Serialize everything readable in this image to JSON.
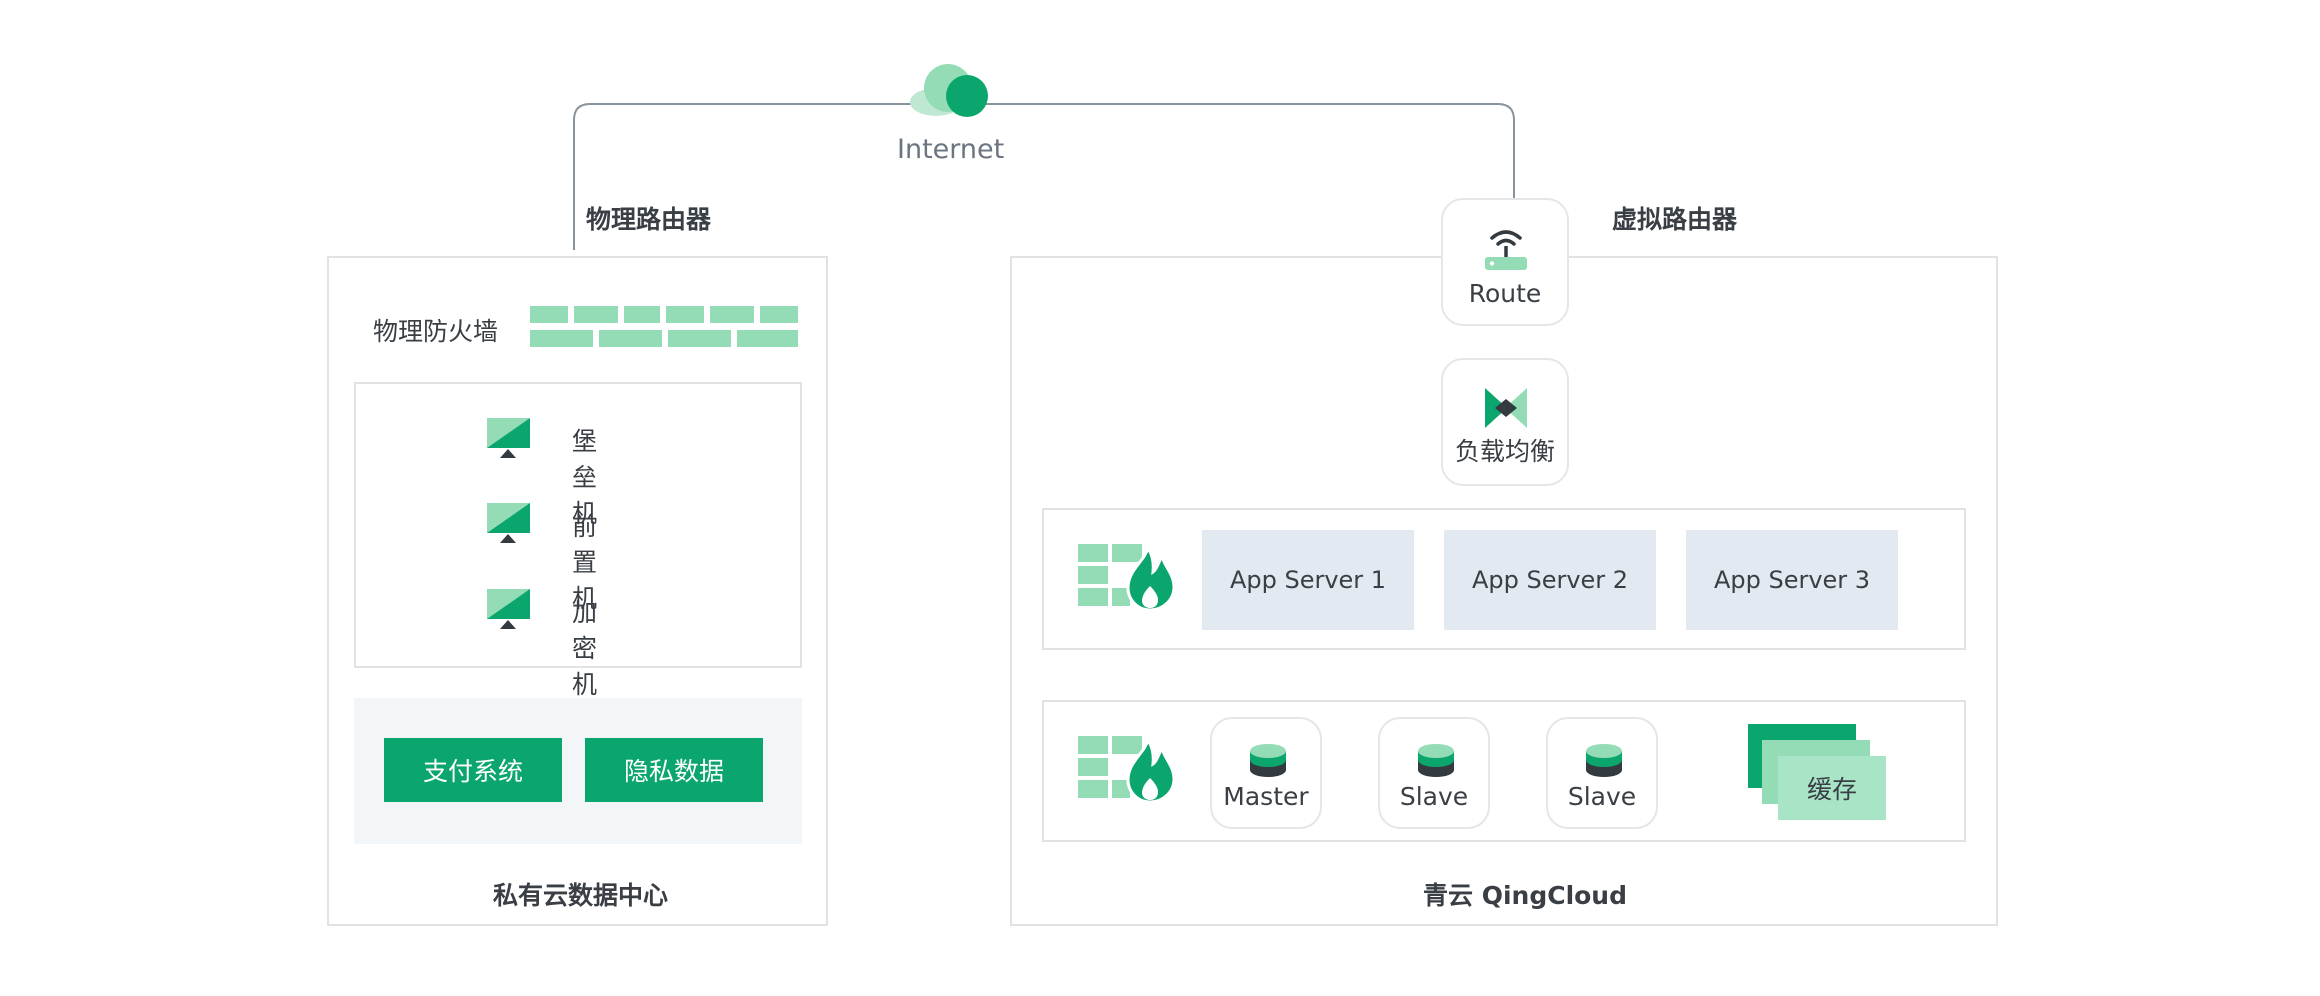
{
  "internet": {
    "label": "Internet",
    "icon": "cloud-icon"
  },
  "private_dc": {
    "router_label": "物理路由器",
    "firewall_label": "物理防火墙",
    "hosts": [
      {
        "label": "堡垒机",
        "icon": "monitor-icon"
      },
      {
        "label": "前置机",
        "icon": "monitor-icon"
      },
      {
        "label": "加密机",
        "icon": "monitor-icon"
      }
    ],
    "systems": [
      "支付系统",
      "隐私数据"
    ],
    "title": "私有云数据中心"
  },
  "qingcloud": {
    "router_label": "虚拟路由器",
    "route_node": {
      "label": "Route",
      "icon": "wifi-router-icon"
    },
    "lb_node": {
      "label": "负载均衡",
      "icon": "load-balancer-icon"
    },
    "app_servers": [
      "App Server 1",
      "App Server 2",
      "App Server 3"
    ],
    "db_nodes": [
      {
        "label": "Master",
        "icon": "database-icon"
      },
      {
        "label": "Slave",
        "icon": "database-icon"
      },
      {
        "label": "Slave",
        "icon": "database-icon"
      }
    ],
    "cache_label": "缓存",
    "title": "青云 QingCloud"
  },
  "colors": {
    "green": "#0aa66e",
    "light_green": "#93dcb6",
    "line": "#8a949c",
    "border": "#dfe3e6",
    "server_bg": "#e3e9f0"
  }
}
